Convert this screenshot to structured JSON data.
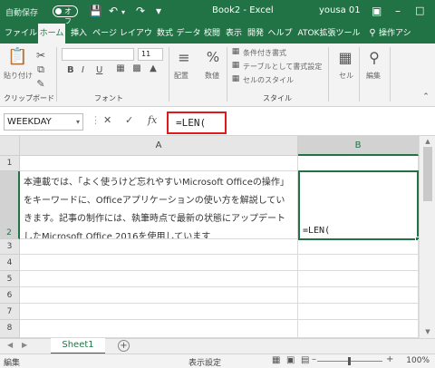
{
  "titlebar": {
    "autosave_label": "自動保存",
    "autosave_state": "オフ",
    "doc_title": "Book2 - Excel",
    "user": "yousa 01",
    "icons": [
      "save-icon",
      "undo-icon",
      "redo-icon",
      "customize-icon"
    ]
  },
  "tabs": [
    "ファイル",
    "ホーム",
    "挿入",
    "ページ レイアウト",
    "数式",
    "データ",
    "校閲",
    "表示",
    "開発",
    "ヘルプ",
    "ATOK拡張ツール",
    "操作アシ"
  ],
  "active_tab": "ホーム",
  "ribbon": {
    "paste": "貼り付け",
    "clipboard": "クリップボード",
    "font": "フォント",
    "font_size": "11",
    "alignment": "配置",
    "number": "数値",
    "number_symbol": "%",
    "conditional": "条件付き書式",
    "table_format": "テーブルとして書式設定",
    "cell_style": "セルのスタイル",
    "style": "スタイル",
    "cells": "セル",
    "editing": "編集",
    "bold": "B",
    "italic": "I",
    "underline": "U"
  },
  "formula_bar": {
    "name_box": "WEEKDAY",
    "cancel": "✕",
    "enter": "✓",
    "fx": "fx",
    "formula": "=LEN("
  },
  "grid": {
    "columns": [
      "A",
      "B"
    ],
    "rows": [
      "1",
      "2",
      "3",
      "4",
      "5",
      "6",
      "7",
      "8"
    ],
    "A2": "本連載では、「よく使うけど忘れやすいMicrosoft Officeの操作」をキーワードに、Officeアプリケーションの使い方を解説していきます。記事の制作には、執筆時点で最新の状態にアップデートしたMicrosoft Office 2016を使用しています",
    "B2": "=LEN("
  },
  "sheets": [
    "Sheet1"
  ],
  "status": {
    "mode": "編集",
    "display_settings": "表示設定",
    "zoom": "100%"
  },
  "colors": {
    "brand": "#217346",
    "highlight": "#e0191a"
  }
}
